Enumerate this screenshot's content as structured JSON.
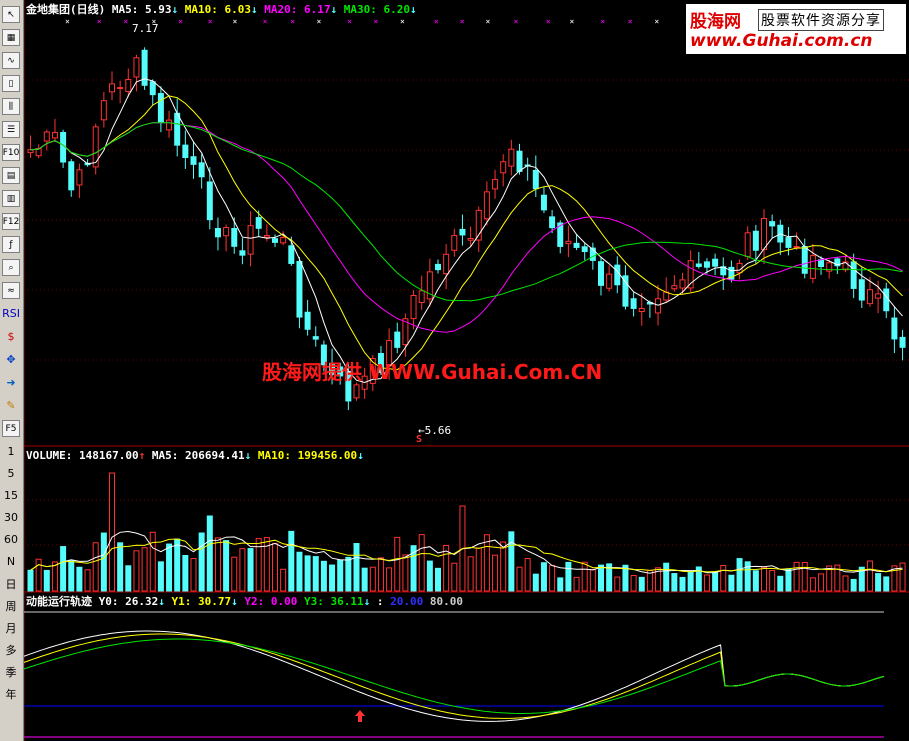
{
  "toolbar": {
    "icon_buttons": [
      {
        "name": "cursor-icon",
        "glyph": "↖"
      },
      {
        "name": "grid-icon",
        "glyph": "▦"
      },
      {
        "name": "line-chart-icon",
        "glyph": "∿"
      },
      {
        "name": "candle-icon",
        "glyph": "▯"
      },
      {
        "name": "kline-icon",
        "glyph": "⫼"
      },
      {
        "name": "list-icon",
        "glyph": "☰"
      },
      {
        "name": "f10-icon",
        "glyph": "F10"
      },
      {
        "name": "report-icon",
        "glyph": "▤"
      },
      {
        "name": "doc-icon",
        "glyph": "▥"
      },
      {
        "name": "f12-icon",
        "glyph": "F12"
      },
      {
        "name": "formula-icon",
        "glyph": "ƒ"
      },
      {
        "name": "search-icon",
        "glyph": "⌕"
      },
      {
        "name": "wave-icon",
        "glyph": "≈"
      }
    ],
    "rsi_label": "RSI",
    "tool_icons": [
      {
        "name": "dollar-icon",
        "glyph": "$",
        "color": "#d00000"
      },
      {
        "name": "move-icon",
        "glyph": "✥",
        "color": "#0040c0"
      },
      {
        "name": "arrow-icon",
        "glyph": "➜",
        "color": "#0060c0"
      },
      {
        "name": "pencil-icon",
        "glyph": "✎",
        "color": "#c08000"
      }
    ],
    "f5_label": "F5",
    "period_buttons": [
      "1",
      "5",
      "15",
      "30",
      "60",
      "N",
      "日",
      "周",
      "月",
      "多",
      "季",
      "年"
    ]
  },
  "price_panel": {
    "title": "金地集团",
    "period": "(日线)",
    "ma5_label": "MA5:",
    "ma5_value": "5.93",
    "ma10_label": "MA10:",
    "ma10_value": "6.03",
    "ma20_label": "MA20:",
    "ma20_value": "6.17",
    "ma30_label": "MA30:",
    "ma30_value": "6.20",
    "arrow_down": "↓",
    "high_label": "7.17",
    "low_label": "5.66",
    "signal_marker": "S"
  },
  "volume_panel": {
    "label": "VOLUME:",
    "value": "148167.00",
    "ma5_label": "MA5:",
    "ma5_value": "206694.41",
    "ma10_label": "MA10:",
    "ma10_value": "199456.00",
    "arrow_up": "↑",
    "arrow_down": "↓"
  },
  "indicator_panel": {
    "name": "动能运行轨迹",
    "y0_label": "Y0:",
    "y0_value": "26.32",
    "y1_label": "Y1:",
    "y1_value": "30.77",
    "y2_label": "Y2:",
    "y2_value": "0.00",
    "y3_label": "Y3:",
    "y3_value": "36.11",
    "level_low": "20.00",
    "level_high": "80.00",
    "arrow_down": "↓"
  },
  "watermark": {
    "logo_text": "股海网",
    "slogan": "股票软件资源分享",
    "url": "www.Guhai.com.cn",
    "center_text": "股海网提供 WWW.Guhai.Com.CN"
  },
  "colors": {
    "background": "#000000",
    "up": "#ff3232",
    "down": "#54fcfc",
    "ma5": "#ffffff",
    "ma10": "#ffff00",
    "ma20": "#ff00ff",
    "ma30": "#00e600",
    "level_blue": "#0000ff",
    "axis_red": "#a00000"
  }
}
